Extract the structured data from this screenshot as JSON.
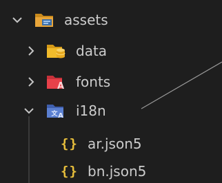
{
  "tree": {
    "items": [
      {
        "label": "assets",
        "icon": "folder-assets-icon",
        "expanded": true
      },
      {
        "label": "data",
        "icon": "folder-data-icon",
        "expanded": false
      },
      {
        "label": "fonts",
        "icon": "folder-fonts-icon",
        "expanded": false
      },
      {
        "label": "i18n",
        "icon": "folder-i18n-icon",
        "expanded": true
      },
      {
        "label": "ar.json5",
        "icon": "json-braces-icon"
      },
      {
        "label": "bn.json5",
        "icon": "json-braces-icon"
      }
    ],
    "braces_glyph": "{}"
  },
  "colors": {
    "background": "#1e1e1e",
    "text": "#cccccc",
    "assets_folder": "#e0a030",
    "data_folder": "#f0b92a",
    "fonts_folder": "#e8414a",
    "i18n_folder": "#4f74c9",
    "json_braces": "#e8bf3c",
    "guide": "#3a3a3a"
  }
}
